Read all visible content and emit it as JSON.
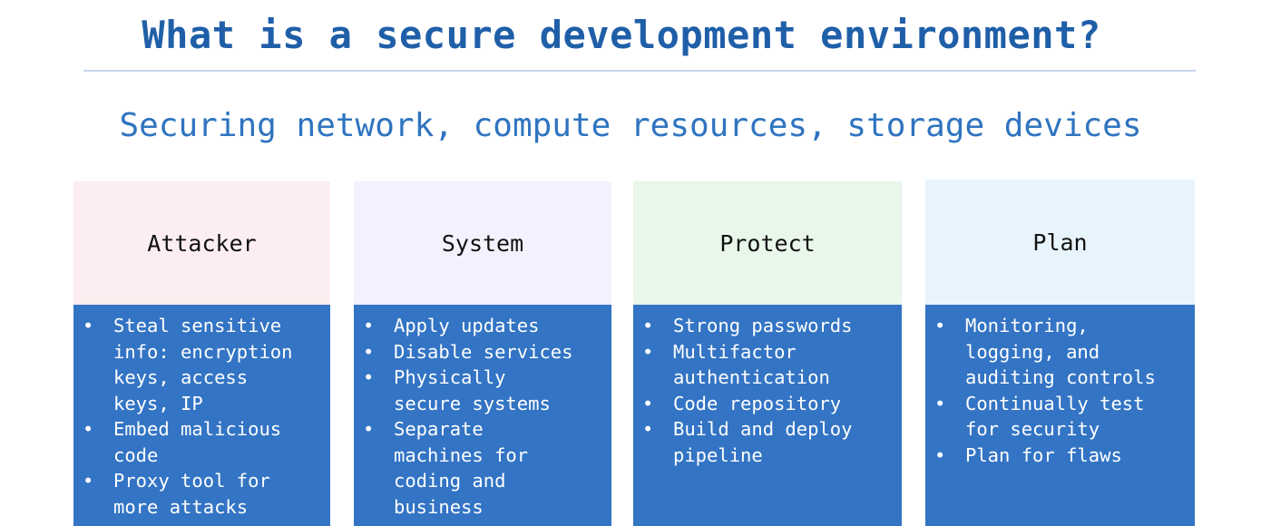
{
  "slide": {
    "title": "What is a secure development environment?",
    "subtitle": "Securing network, compute resources, storage devices"
  },
  "colors": {
    "title": "#1f5fa8",
    "subtitle": "#2f74c0",
    "panel_body": "#3374c4"
  },
  "columns": [
    {
      "heading": "Attacker",
      "header_color": "#fcedf0",
      "items": [
        [
          "Steal sensitive",
          "info: encryption",
          "keys, access",
          "keys, IP"
        ],
        [
          "Embed malicious",
          "code"
        ],
        [
          "Proxy tool for",
          "more attacks"
        ]
      ]
    },
    {
      "heading": "System",
      "header_color": "#f3f1fd",
      "items": [
        [
          "Apply updates"
        ],
        [
          "Disable services"
        ],
        [
          "Physically",
          "secure systems"
        ],
        [
          "Separate",
          "machines for",
          "coding and",
          "business"
        ]
      ]
    },
    {
      "heading": "Protect",
      "header_color": "#e9f6ea",
      "items": [
        [
          "Strong passwords"
        ],
        [
          "Multifactor",
          "authentication"
        ],
        [
          "Code repository"
        ],
        [
          "Build and deploy",
          "pipeline"
        ]
      ]
    },
    {
      "heading": "Plan",
      "header_color": "#e8f4fc",
      "items": [
        [
          "Monitoring,",
          "logging, and",
          "auditing controls"
        ],
        [
          "Continually test",
          "for security"
        ],
        [
          "Plan for flaws"
        ]
      ]
    }
  ]
}
